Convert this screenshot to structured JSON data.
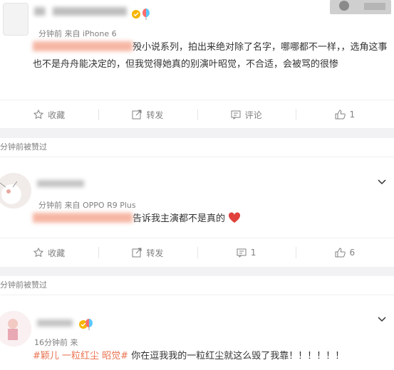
{
  "colors": {
    "topic": "#eb7350",
    "gray_text": "#808080",
    "separator": "#f2f2f5",
    "heart": "#e0413c"
  },
  "posts": [
    {
      "username": "",
      "meta": "分钟前 来自 iPhone 6",
      "text": "殁小说系列，拍出来绝对除了名字，哪哪都不一样，，选角这事也不是舟舟能决定的，但我觉得她真的别演叶昭觉，不合适，会被骂的很惨",
      "actions": {
        "collect": "收藏",
        "forward": "转发",
        "comment": "评论",
        "like": "1"
      }
    },
    {
      "praise_note": "分钟前被赞过",
      "username": "",
      "meta": "分钟前 来自 OPPO R9 Plus",
      "text": "告诉我主演都不是真的",
      "actions": {
        "collect": "收藏",
        "forward": "转发",
        "comment": "1",
        "like": "6"
      }
    },
    {
      "praise_note": "分钟前被赞过",
      "username": "",
      "meta": "16分钟前 来",
      "topic": "#颖儿 一粒红尘 昭觉#",
      "text": " 你在逗我我的一粒红尘就这么毁了我靠！！！！！！"
    }
  ],
  "icons": [
    "chevron-down-icon",
    "star-icon",
    "forward-icon",
    "comment-icon",
    "like-icon",
    "heart-icon",
    "vip-badge-icon"
  ]
}
